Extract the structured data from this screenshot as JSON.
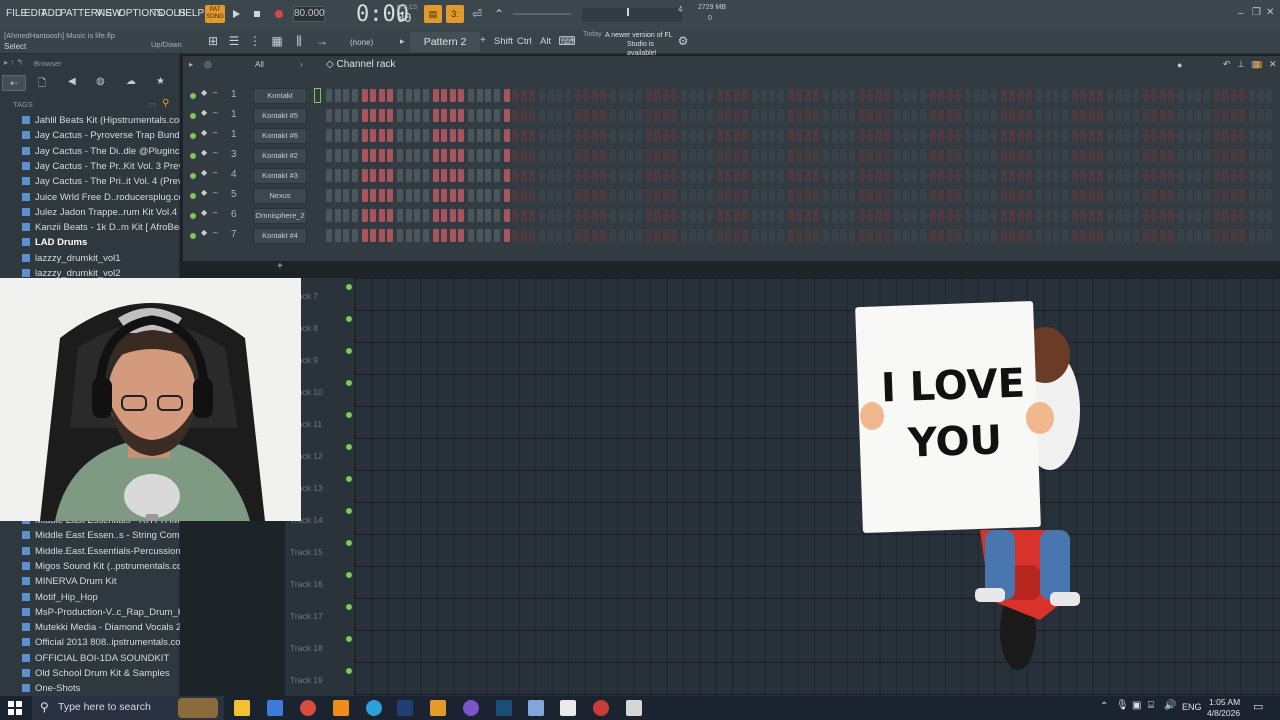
{
  "menu": [
    "FILE",
    "EDIT",
    "ADD",
    "PATTERNS",
    "VIEW",
    "OPTIONS",
    "TOOLS",
    "HELP"
  ],
  "transport": {
    "tempo": "80.000",
    "time": "0:00",
    "time_small": "00",
    "time_label": "M:S:CS",
    "memory": "2729 MB",
    "cpu_num": "4",
    "poly": "0"
  },
  "file_info": {
    "user_file": "[AhmedHantoosh] Music is life.flp",
    "hint": "Select",
    "updown": "Up/Down"
  },
  "toolbar": {
    "preset": "(none)",
    "pattern": "Pattern 2",
    "shift": "Shift",
    "ctrl": "Ctrl",
    "alt": "Alt",
    "news_day": "Today",
    "news_text": "A newer version of FL Studio is available!"
  },
  "browser": {
    "title": "Browser",
    "tags": "TAGS",
    "items_top": [
      "Jahlil Beats Kit (Hipstrumentals.com)",
      "Jay Cactus - Pyroverse Trap Bundle",
      "Jay Cactus - The Di..dle @Pluginclouds",
      "Jay Cactus - The Pr..Kit Vol. 3 Preview",
      "Jay Cactus - The Pri..it Vol. 4 (Preview)",
      "Juice Wrld Free D..roducersplug.com)",
      "Julez Jadon Trappe..rum Kit Vol.4 WAV",
      "Kanzii Beats - 1k D..m Kit [ AfroBeats ]",
      "LAD Drums",
      "lazzzy_drumkit_vol1",
      "lazzzy_drumkit_vol2"
    ],
    "items_bottom": [
      "Middle East Essentials - RHYTHMS",
      "Middle East Essen..s - String Company",
      "Middle.East.Essentials-Percussion",
      "Migos Sound Kit (..pstrumentals.com)",
      "MINERVA Drum Kit",
      "Motif_Hip_Hop",
      "MsP-Production-V..c_Rap_Drum_Kit_3",
      "Mutekki Media - Diamond Vocals 2",
      "Official 2013 808..ipstrumentals.com)",
      "OFFICIAL BOI-1DA SOUNDKIT",
      "Old School Drum Kit & Samples",
      "One-Shots"
    ]
  },
  "rack": {
    "filter": "All",
    "title": "Channel rack",
    "channels": [
      {
        "num": "1",
        "name": "Kontakt"
      },
      {
        "num": "1",
        "name": "Kontakt #5"
      },
      {
        "num": "1",
        "name": "Kontakt #6"
      },
      {
        "num": "3",
        "name": "Kontakt #2"
      },
      {
        "num": "4",
        "name": "Kontakt #3"
      },
      {
        "num": "5",
        "name": "Nexus"
      },
      {
        "num": "6",
        "name": "Omnisphere_2"
      },
      {
        "num": "7",
        "name": "Kontakt #4"
      }
    ]
  },
  "playlist": {
    "tracks": [
      "Track 7",
      "Track 8",
      "Track 9",
      "Track 10",
      "Track 11",
      "Track 12",
      "Track 13",
      "Track 14",
      "Track 15",
      "Track 16",
      "Track 17",
      "Track 18",
      "Track 19"
    ]
  },
  "sticker": {
    "line1": "I LOVE",
    "line2": "YOU"
  },
  "taskbar": {
    "search_placeholder": "Type here to search",
    "lang": "ENG",
    "time": "1:05 AM",
    "date": "4/8/2026"
  },
  "colors": {
    "accent_orange": "#e29a2b",
    "led_green": "#7ec850",
    "step_red": "#a8545d",
    "step_gray": "#4b565d"
  }
}
